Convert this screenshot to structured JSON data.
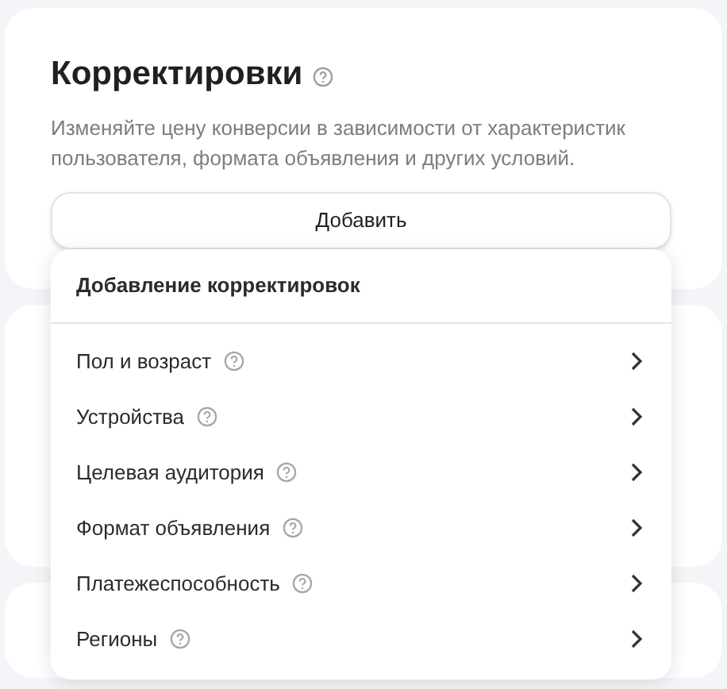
{
  "section": {
    "title": "Корректировки",
    "description": "Изменяйте цену конверсии в зависимости от характеристик пользователя, формата объявления и других условий.",
    "add_button": "Добавить"
  },
  "dropdown": {
    "header": "Добавление корректировок",
    "items": [
      {
        "label": "Пол и возраст"
      },
      {
        "label": "Устройства"
      },
      {
        "label": "Целевая аудитория"
      },
      {
        "label": "Формат объявления"
      },
      {
        "label": "Платежеспособность"
      },
      {
        "label": "Регионы"
      }
    ]
  }
}
